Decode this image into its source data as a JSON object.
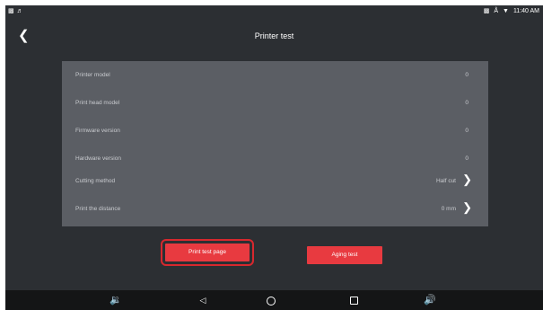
{
  "statusbar": {
    "time": "11:40 AM",
    "icons": [
      "notification-icon",
      "volume-icon",
      "battery-icon",
      "bluetooth-icon",
      "wifi-icon"
    ]
  },
  "header": {
    "title": "Printer test",
    "back_icon": "chevron-left-icon"
  },
  "info_rows": [
    {
      "label": "Printer model",
      "value": "0"
    },
    {
      "label": "Print head model",
      "value": "0"
    },
    {
      "label": "Firmware version",
      "value": "0"
    },
    {
      "label": "Hardware version",
      "value": "0"
    },
    {
      "label": "Cutting method",
      "value": "Half cut"
    },
    {
      "label": "Print the distance",
      "value": "0 mm"
    }
  ],
  "buttons": {
    "print_test_page": "Print test page",
    "aging_test": "Aging test"
  },
  "navbar": {
    "icons": [
      "volume-down-icon",
      "back-icon",
      "home-icon",
      "recents-icon",
      "volume-up-icon"
    ]
  },
  "colors": {
    "background": "#2c2f33",
    "panel": "#5b5e64",
    "accent": "#e83a40",
    "navbar": "#141516"
  }
}
